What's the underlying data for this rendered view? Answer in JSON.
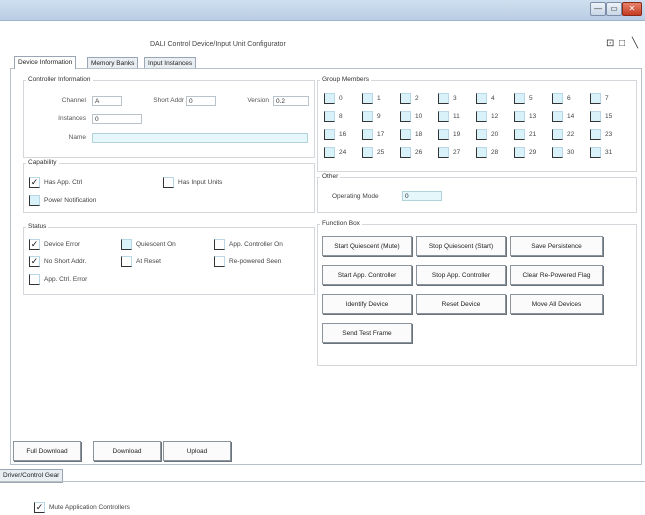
{
  "window": {
    "minimize": "—",
    "restore": "▭",
    "close": "✕"
  },
  "document_title": "DALI Control Device/Input Unit Configurator",
  "toolbar": {
    "pin_icon": "⊡",
    "dock_icon": "□",
    "chevron_icon": "╲"
  },
  "tabs": [
    "Device Information",
    "Memory Banks",
    "Input Instances"
  ],
  "controller_info": {
    "title": "Controller Information",
    "channel_label": "Channel",
    "channel_value": "A",
    "short_addr_label": "Short Addr",
    "short_addr_value": "0",
    "version_label": "Version",
    "version_value": "0.2",
    "instances_label": "Instances",
    "instances_value": "0",
    "name_label": "Name",
    "name_value": ""
  },
  "group_members": {
    "title": "Group Members",
    "items": [
      "0",
      "1",
      "2",
      "3",
      "4",
      "5",
      "6",
      "7",
      "8",
      "9",
      "10",
      "11",
      "12",
      "13",
      "14",
      "15",
      "16",
      "17",
      "18",
      "19",
      "20",
      "21",
      "22",
      "23",
      "24",
      "25",
      "26",
      "27",
      "28",
      "29",
      "30",
      "31"
    ]
  },
  "capability": {
    "title": "Capability",
    "has_app_ctrl": {
      "label": "Has App. Ctrl",
      "checked": "✓"
    },
    "has_input_units": {
      "label": "Has Input Units",
      "checked": ""
    },
    "power_notification": {
      "label": "Power Notification",
      "checked": ""
    }
  },
  "other": {
    "title": "Other",
    "operating_mode_label": "Operating Mode",
    "operating_mode_value": "0"
  },
  "status": {
    "title": "Status",
    "device_error": {
      "label": "Device Error",
      "checked": "✓"
    },
    "quiescent_on": {
      "label": "Quiescent On",
      "checked": ""
    },
    "app_controller_on": {
      "label": "App. Controller On",
      "checked": ""
    },
    "no_short_addr": {
      "label": "No Short Addr.",
      "checked": "✓"
    },
    "at_reset": {
      "label": "At Reset",
      "checked": ""
    },
    "re_powered_seen": {
      "label": "Re-powered Seen",
      "checked": ""
    },
    "app_ctrl_error": {
      "label": "App. Ctrl. Error",
      "checked": ""
    }
  },
  "function_box": {
    "title": "Function Box",
    "buttons": [
      "Start Quiescent (Mute)",
      "Stop Quiescent (Start)",
      "Save Persistence",
      "Start App. Controller",
      "Stop App. Controller",
      "Clear Re-Powered Flag",
      "Identify Device",
      "Reset Device",
      "Move All Devices",
      "Send Test Frame"
    ]
  },
  "footer_buttons": {
    "full_download": "Full Download",
    "download": "Download",
    "upload": "Upload"
  },
  "bottom_tab": "Driver/Control Gear",
  "mute_controllers": {
    "label": "Mute Application Controllers",
    "checked": "✓"
  }
}
